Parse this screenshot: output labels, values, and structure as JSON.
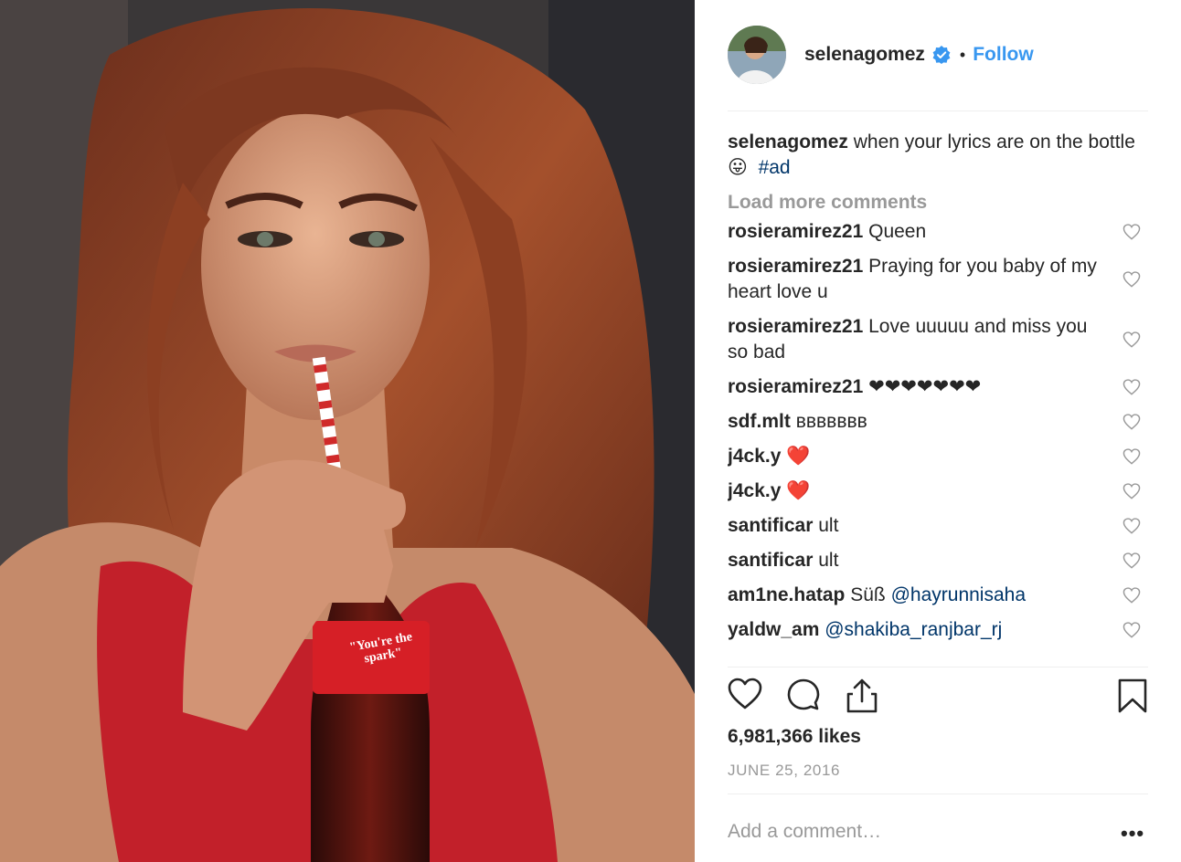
{
  "header": {
    "username": "selenagomez",
    "separator": "•",
    "follow_label": "Follow"
  },
  "caption": {
    "username": "selenagomez",
    "text": "when your lyrics are on the bottle",
    "emoji": "😛",
    "hashtag": "#ad"
  },
  "load_more_label": "Load more comments",
  "comments": [
    {
      "user": "rosieramirez21",
      "text": "Queen",
      "mention": ""
    },
    {
      "user": "rosieramirez21",
      "text": "Praying for you baby of my heart love u",
      "mention": ""
    },
    {
      "user": "rosieramirez21",
      "text": "Love uuuuu and miss you so bad",
      "mention": ""
    },
    {
      "user": "rosieramirez21",
      "text": "❤❤❤❤❤❤❤",
      "mention": ""
    },
    {
      "user": "sdf.mlt",
      "text": "ʙʙʙʙʙʙʙ",
      "mention": ""
    },
    {
      "user": "j4ck.y",
      "text": "❤️",
      "mention": ""
    },
    {
      "user": "j4ck.y",
      "text": "❤️",
      "mention": ""
    },
    {
      "user": "santificar",
      "text": "ult",
      "mention": ""
    },
    {
      "user": "santificar",
      "text": "ult",
      "mention": ""
    },
    {
      "user": "am1ne.hatap",
      "text": "Süß",
      "mention": "@hayrunnisaha"
    },
    {
      "user": "yaldw_am",
      "text": "",
      "mention": "@shakiba_ranjbar_rj"
    }
  ],
  "likes": "6,981,366 likes",
  "date": "JUNE 25, 2016",
  "add_comment_placeholder": "Add a comment…",
  "more_options_label": "•••",
  "photo_bottle_text": "\"You're the spark\"",
  "colors": {
    "accent": "#3897f0",
    "verified": "#3897f0",
    "hashtag": "#003569",
    "muted": "#999999",
    "text": "#262626"
  },
  "icons": [
    "verified-badge-icon",
    "heart-icon",
    "comment-icon",
    "share-icon",
    "bookmark-icon",
    "more-options-icon"
  ]
}
